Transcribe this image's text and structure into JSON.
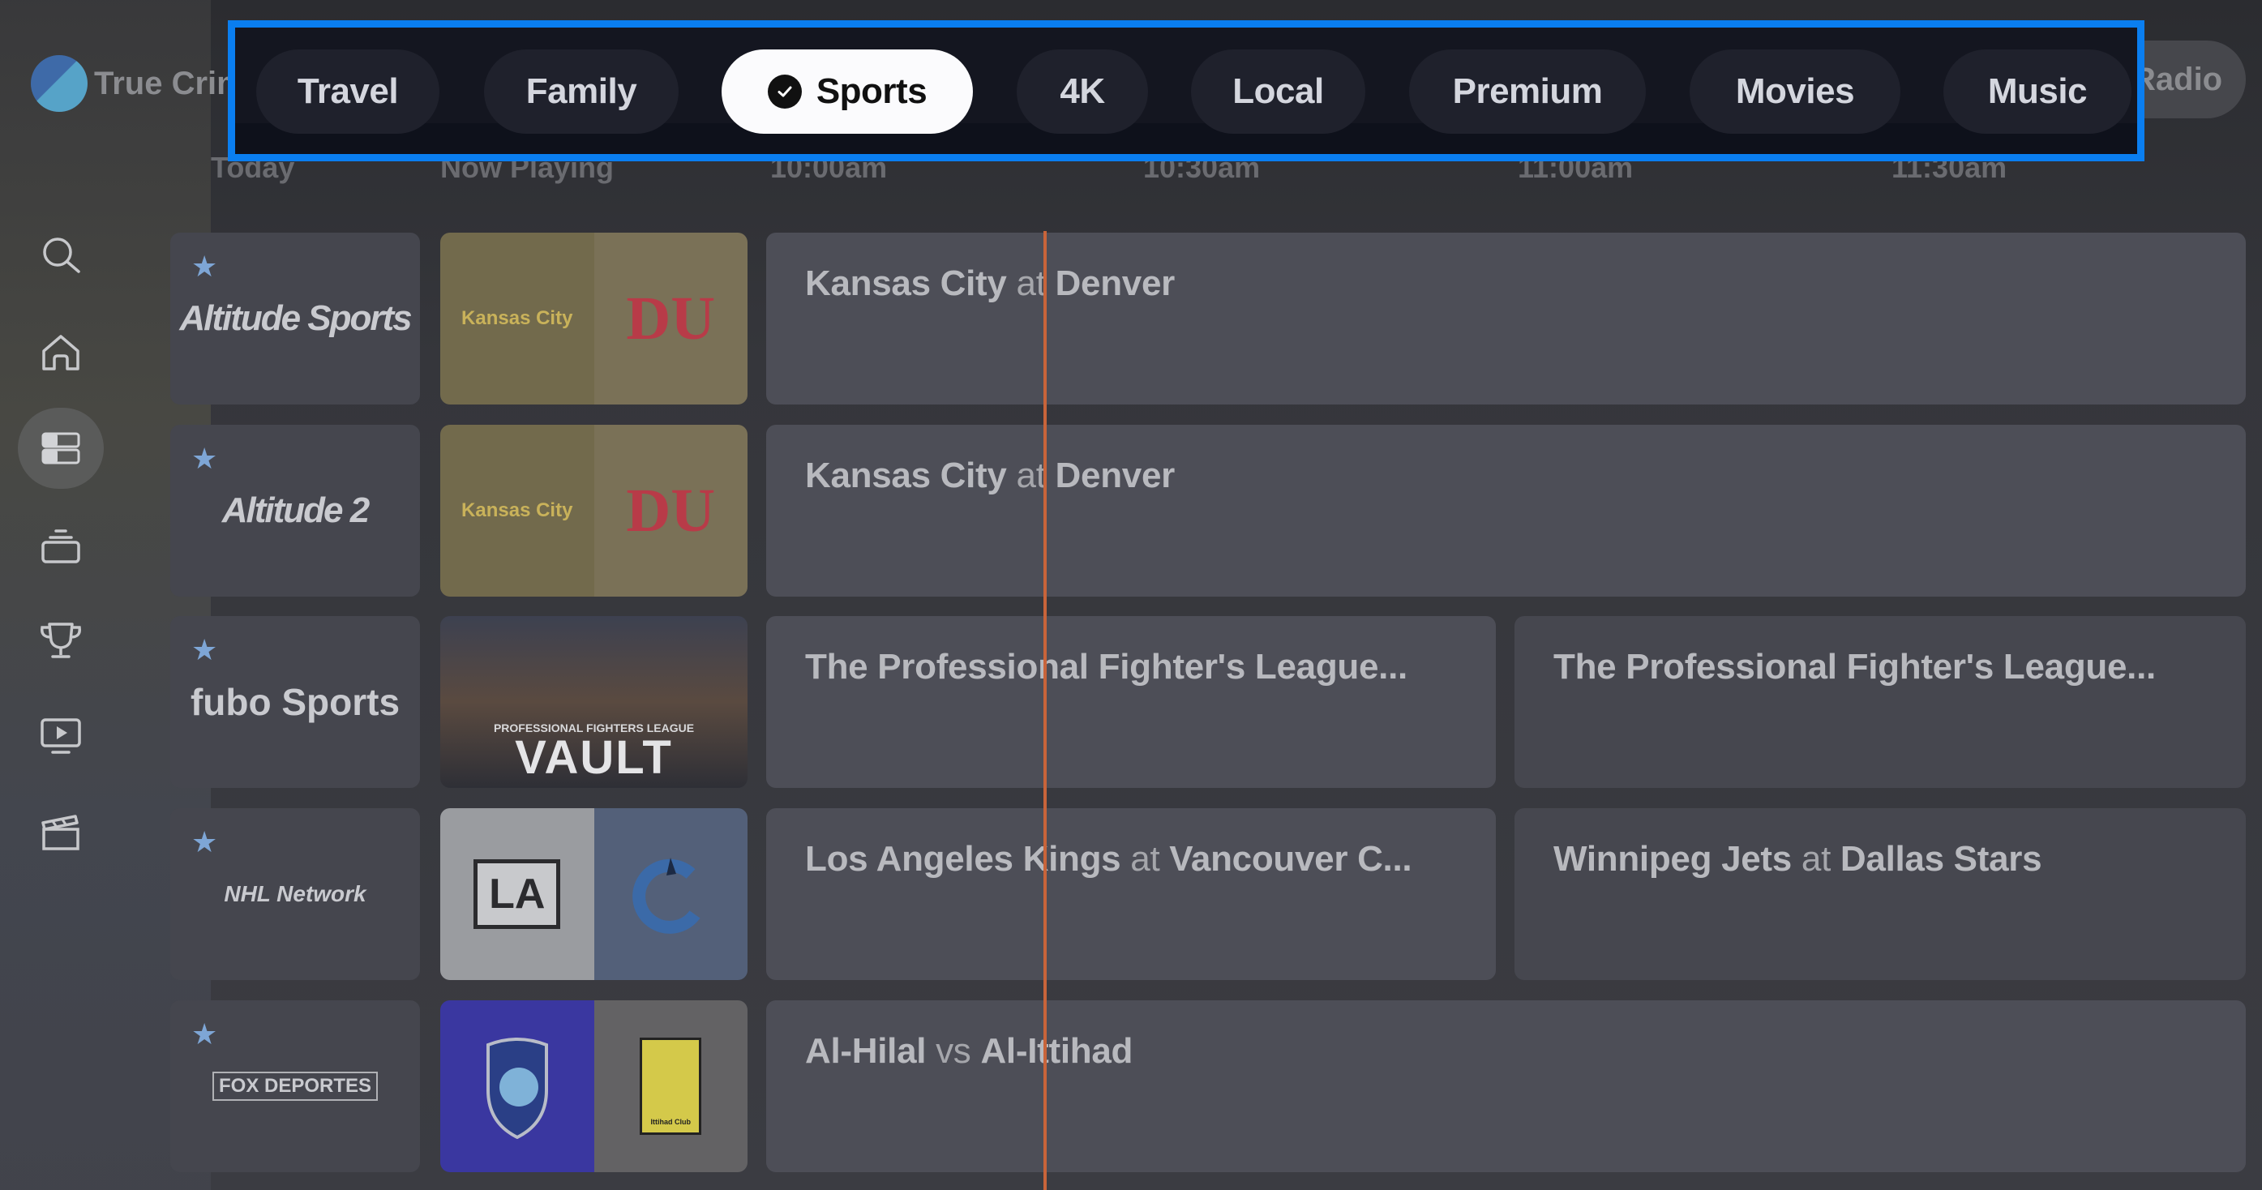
{
  "brand": {
    "name": "True Crime",
    "logo_icon": "channel-logo-icon"
  },
  "filters": {
    "items": [
      {
        "label": "Travel",
        "active": false
      },
      {
        "label": "Family",
        "active": false
      },
      {
        "label": "Sports",
        "active": true,
        "icon": "check-circle-icon"
      },
      {
        "label": "4K",
        "active": false
      },
      {
        "label": "Local",
        "active": false
      },
      {
        "label": "Premium",
        "active": false
      },
      {
        "label": "Movies",
        "active": false
      },
      {
        "label": "Music",
        "active": false
      }
    ],
    "overflow_label": "Radio",
    "highlight_color": "#0a7ef0"
  },
  "header": {
    "day": "Today",
    "now_playing": "Now Playing",
    "times": [
      "10:00am",
      "10:30am",
      "11:00am",
      "11:30am"
    ]
  },
  "sidebar": {
    "items": [
      {
        "icon": "search-icon",
        "label": "Search",
        "active": false
      },
      {
        "icon": "home-icon",
        "label": "Home",
        "active": false
      },
      {
        "icon": "guide-icon",
        "label": "Guide",
        "active": true
      },
      {
        "icon": "tv-icon",
        "label": "Live TV",
        "active": false
      },
      {
        "icon": "trophy-icon",
        "label": "Sports",
        "active": false
      },
      {
        "icon": "play-screen-icon",
        "label": "Recordings",
        "active": false
      },
      {
        "icon": "clapperboard-icon",
        "label": "Movies",
        "active": false
      }
    ]
  },
  "now_line_color": "#c8643a",
  "rows": [
    {
      "channel": "Altitude Sports",
      "favorite": true,
      "thumb": {
        "left": "Kansas City",
        "right": "DU",
        "left_bg": "#726a4c",
        "right_bg": "#7a7157"
      },
      "programs": [
        {
          "parts": [
            {
              "t": "Kansas City",
              "b": true
            },
            {
              "t": " at ",
              "b": false
            },
            {
              "t": "Denver",
              "b": true
            }
          ]
        }
      ]
    },
    {
      "channel": "Altitude 2",
      "favorite": true,
      "thumb": {
        "left": "Kansas City",
        "right": "DU",
        "left_bg": "#726a4c",
        "right_bg": "#7a7157"
      },
      "programs": [
        {
          "parts": [
            {
              "t": "Kansas City",
              "b": true
            },
            {
              "t": " at ",
              "b": false
            },
            {
              "t": "Denver",
              "b": true
            }
          ]
        }
      ]
    },
    {
      "channel": "fubo Sports",
      "favorite": true,
      "thumb": {
        "caption_top": "PROFESSIONAL FIGHTERS LEAGUE",
        "caption": "VAULT"
      },
      "programs": [
        {
          "parts": [
            {
              "t": "The Professional Fighter's League...",
              "b": false
            }
          ]
        },
        {
          "parts": [
            {
              "t": "The Professional Fighter's League...",
              "b": false
            }
          ]
        }
      ]
    },
    {
      "channel": "NHL Network",
      "favorite": true,
      "thumb": {
        "left": "LA",
        "right": "Canucks",
        "left_bg": "#9a9ca0",
        "right_bg": "#536079"
      },
      "programs": [
        {
          "parts": [
            {
              "t": "Los Angeles Kings",
              "b": true
            },
            {
              "t": " at ",
              "b": false
            },
            {
              "t": "Vancouver C...",
              "b": true
            }
          ]
        },
        {
          "parts": [
            {
              "t": "Winnipeg Jets",
              "b": true
            },
            {
              "t": " at ",
              "b": false
            },
            {
              "t": "Dallas Stars",
              "b": true
            }
          ]
        }
      ]
    },
    {
      "channel": "FOX DEPORTES",
      "favorite": true,
      "thumb": {
        "left": "Al-Hilal S. FC",
        "right": "Ittihad Club",
        "left_bg": "#3a37a0",
        "right_bg": "#636264"
      },
      "programs": [
        {
          "parts": [
            {
              "t": "Al-Hilal",
              "b": true
            },
            {
              "t": " vs ",
              "b": false
            },
            {
              "t": "Al-Ittihad",
              "b": true
            }
          ]
        }
      ]
    }
  ]
}
